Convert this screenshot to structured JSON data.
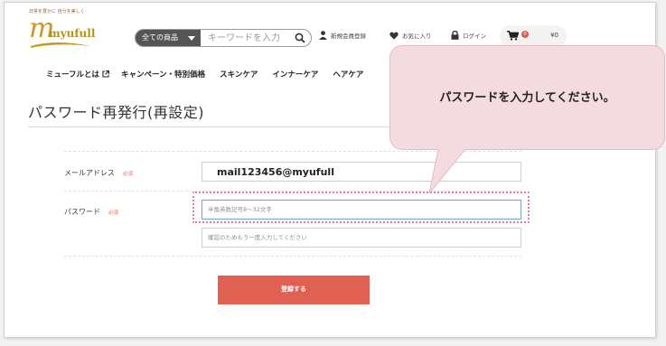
{
  "header": {
    "logo_tagline": "日常を豊かに 自分を美しく",
    "logo_text": "myufull",
    "search_category": "全ての商品",
    "search_placeholder": "キーワードを入力",
    "register_label": "新規会員登録",
    "favorites_label": "お気に入り",
    "login_label": "ログイン",
    "cart_count": "0",
    "cart_total": "¥0"
  },
  "nav": {
    "items": [
      "ミューフルとは",
      "キャンペーン・特別価格",
      "スキンケア",
      "インナーケア",
      "ヘアケア"
    ]
  },
  "page": {
    "title": "パスワード再発行(再設定)"
  },
  "form": {
    "email_label": "メールアドレス",
    "email_required": "必須",
    "email_value": "mail123456@myufull",
    "password_label": "パスワード",
    "password_required": "必須",
    "password_placeholder": "半角英数記号8〜32文字",
    "password_confirm_placeholder": "確認のためもう一度入力してください",
    "submit_label": "登録する"
  },
  "callout": {
    "text": "パスワードを入力してください。"
  },
  "colors": {
    "accent": "#e06052",
    "logo_gold": "#c89a1e",
    "callout_bg": "#f4dbe0",
    "highlight_border": "#e87aa0"
  }
}
